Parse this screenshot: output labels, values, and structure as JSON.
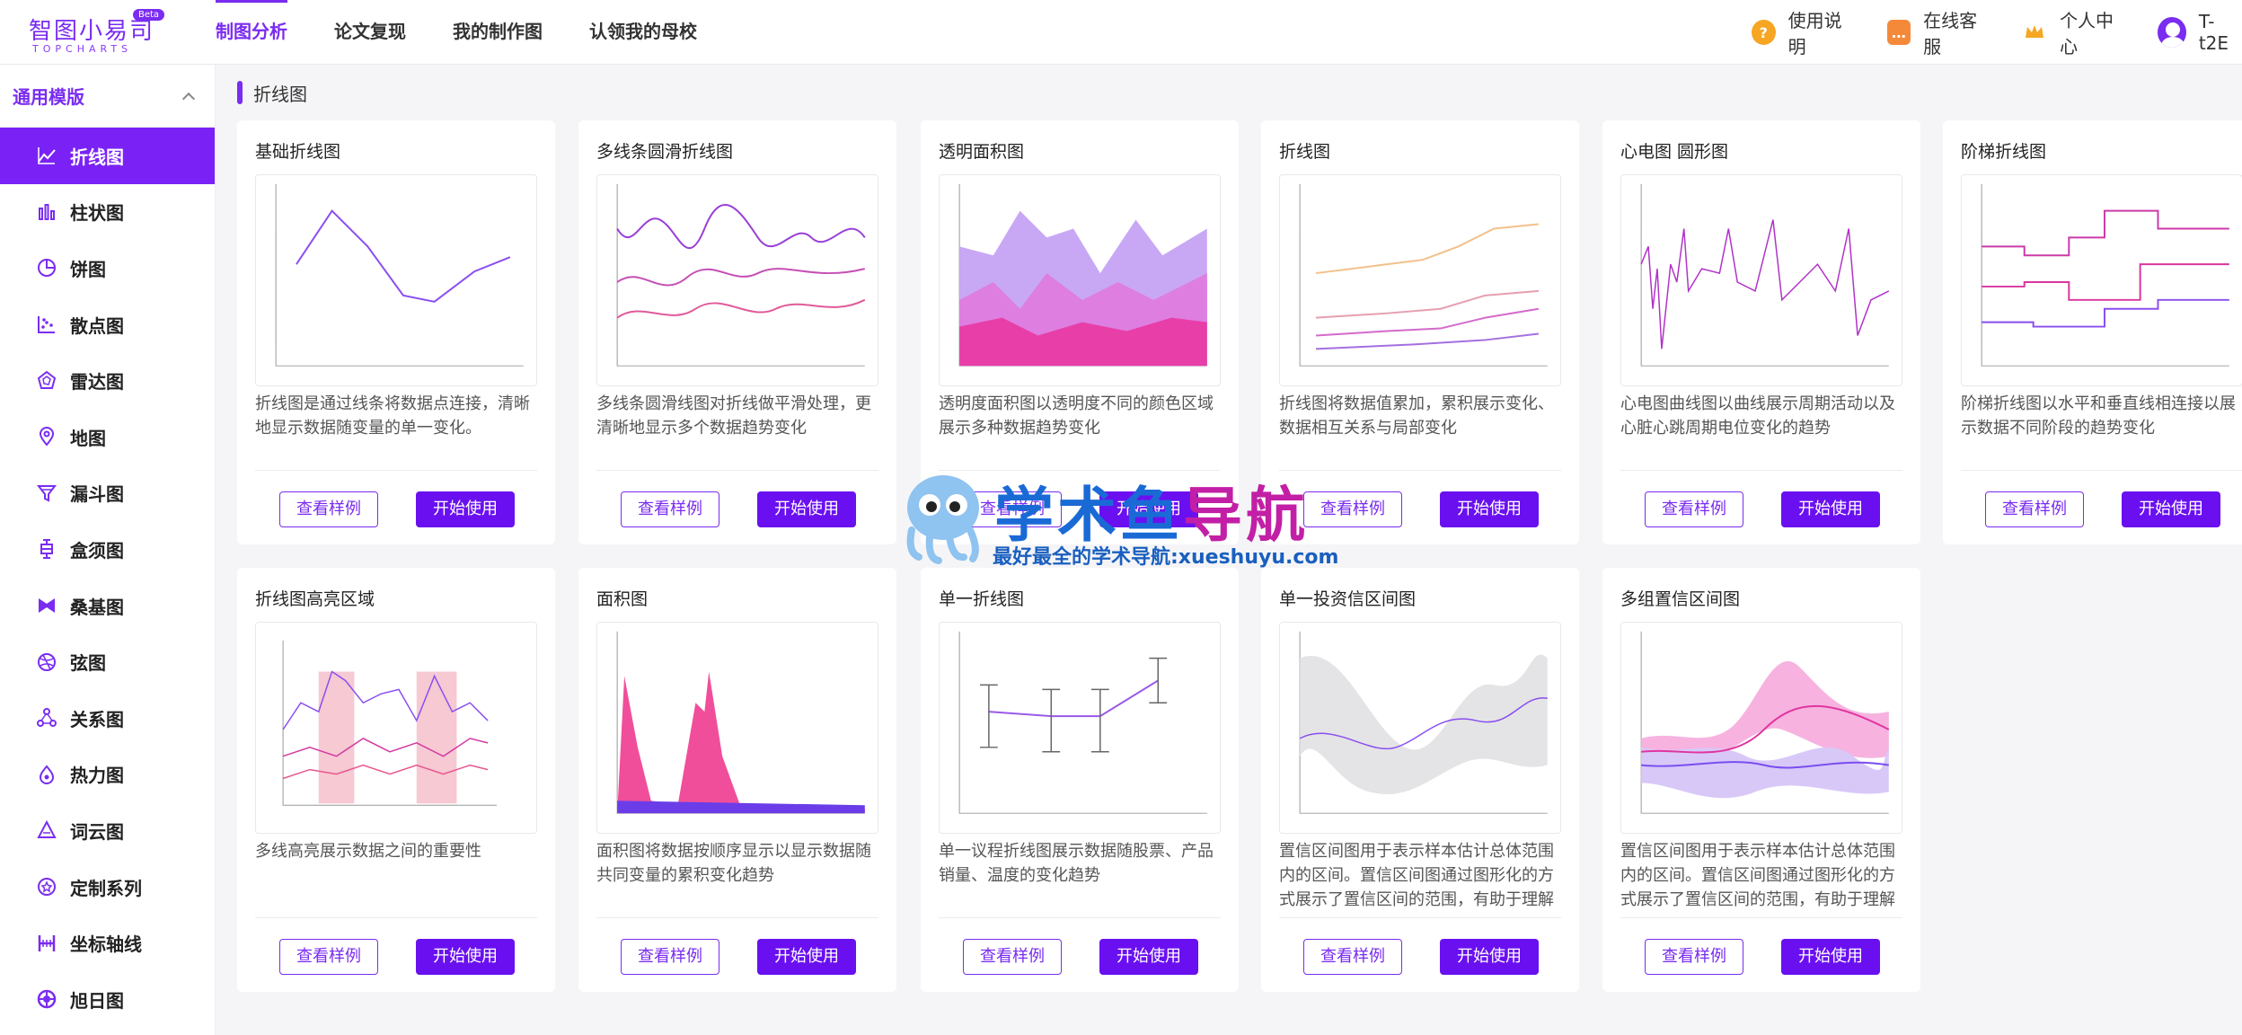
{
  "header": {
    "logo_text": "智图小易司",
    "logo_sub": "TOPCHARTS",
    "beta": "Beta",
    "nav": [
      {
        "label": "制图分析"
      },
      {
        "label": "论文复现"
      },
      {
        "label": "我的制作图"
      },
      {
        "label": "认领我的母校"
      }
    ],
    "help": "使用说明",
    "service": "在线客服",
    "personal": "个人中心",
    "user": "T-t2E"
  },
  "sidebar": {
    "title": "通用模版",
    "items": [
      {
        "label": "折线图",
        "icon": "line-chart-icon"
      },
      {
        "label": "柱状图",
        "icon": "bar-chart-icon"
      },
      {
        "label": "饼图",
        "icon": "pie-chart-icon"
      },
      {
        "label": "散点图",
        "icon": "scatter-icon"
      },
      {
        "label": "雷达图",
        "icon": "radar-icon"
      },
      {
        "label": "地图",
        "icon": "map-pin-icon"
      },
      {
        "label": "漏斗图",
        "icon": "funnel-icon"
      },
      {
        "label": "盒须图",
        "icon": "boxplot-icon"
      },
      {
        "label": "桑基图",
        "icon": "sankey-icon"
      },
      {
        "label": "弦图",
        "icon": "chord-icon"
      },
      {
        "label": "关系图",
        "icon": "graph-icon"
      },
      {
        "label": "热力图",
        "icon": "heatmap-icon"
      },
      {
        "label": "词云图",
        "icon": "wordcloud-icon"
      },
      {
        "label": "定制系列",
        "icon": "custom-icon"
      },
      {
        "label": "坐标轴线",
        "icon": "axis-icon"
      },
      {
        "label": "旭日图",
        "icon": "sunburst-icon"
      }
    ]
  },
  "section": {
    "title": "折线图"
  },
  "buttons": {
    "example": "查看样例",
    "start": "开始使用"
  },
  "cards": [
    {
      "title": "基础折线图",
      "desc": "折线图是通过线条将数据点连接，清晰地显示数据随变量的单一变化。"
    },
    {
      "title": "多线条圆滑折线图",
      "desc": "多线条圆滑线图对折线做平滑处理，更清晰地显示多个数据趋势变化"
    },
    {
      "title": "透明面积图",
      "desc": "透明度面积图以透明度不同的颜色区域展示多种数据趋势变化"
    },
    {
      "title": "折线图",
      "desc": "折线图将数据值累加，累积展示变化、数据相互关系与局部变化"
    },
    {
      "title": "心电图 圆形图",
      "desc": "心电图曲线图以曲线展示周期活动以及心脏心跳周期电位变化的趋势"
    },
    {
      "title": "阶梯折线图",
      "desc": "阶梯折线图以水平和垂直线相连接以展示数据不同阶段的趋势变化"
    },
    {
      "title": "折线图高亮区域",
      "desc": "多线高亮展示数据之间的重要性"
    },
    {
      "title": "面积图",
      "desc": "面积图将数据按顺序显示以显示数据随共同变量的累积变化趋势"
    },
    {
      "title": "单一折线图",
      "desc": "单一议程折线图展示数据随股票、产品销量、温度的变化趋势"
    },
    {
      "title": "单一投资信区间图",
      "desc": "置信区间图用于表示样本估计总体范围内的区间。置信区间图通过图形化的方式展示了置信区间的范围，有助于理解在特..."
    },
    {
      "title": "多组置信区间图",
      "desc": "置信区间图用于表示样本估计总体范围内的区间。置信区间图通过图形化的方式展示了置信区间的范围，有助于理解在特..."
    }
  ],
  "watermark": {
    "title_a": "学术鱼",
    "title_b": "导航",
    "sub": "最好最全的学术导航:xueshuyu.com"
  },
  "colors": {
    "accent": "#7a2cf0",
    "button": "#6a10f0"
  }
}
